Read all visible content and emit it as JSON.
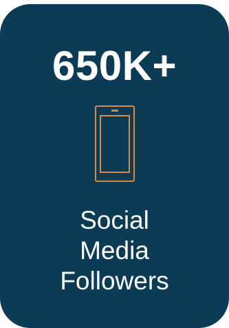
{
  "card": {
    "stat_value": "650K+",
    "icon": "smartphone-icon",
    "label_lines": [
      "Social",
      "Media",
      "Followers"
    ]
  },
  "colors": {
    "card_background": "#0c3b56",
    "icon_stroke": "#d98a45",
    "text": "#ffffff"
  }
}
